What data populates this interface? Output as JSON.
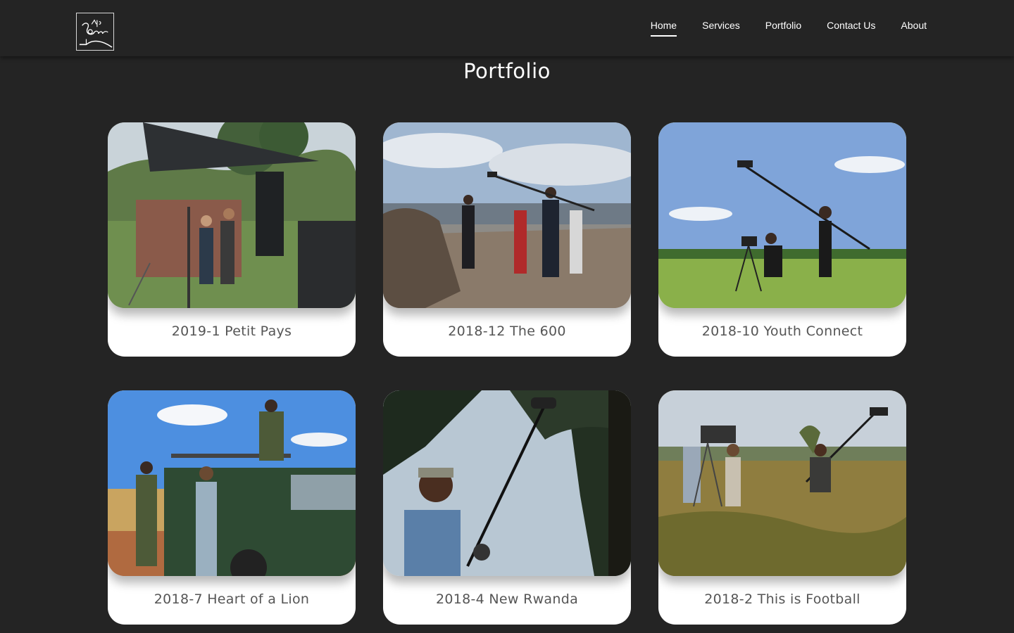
{
  "header": {
    "logo_alt": "Safari Sound",
    "nav": [
      {
        "label": "Home",
        "active": true
      },
      {
        "label": "Services",
        "active": false
      },
      {
        "label": "Portfolio",
        "active": false
      },
      {
        "label": "Contact Us",
        "active": false
      },
      {
        "label": "About",
        "active": false
      }
    ]
  },
  "main": {
    "title": "Portfolio",
    "projects": [
      {
        "title": "2019-1 Petit Pays",
        "image": "film-set-tent-photo"
      },
      {
        "title": "2018-12 The 600",
        "image": "crew-at-memorial-photo"
      },
      {
        "title": "2018-10 Youth Connect",
        "image": "boom-operator-field-photo"
      },
      {
        "title": "2018-7 Heart of a Lion",
        "image": "crew-with-truck-photo"
      },
      {
        "title": "2018-4 New Rwanda",
        "image": "sound-recordist-trees-photo"
      },
      {
        "title": "2018-2 This is Football",
        "image": "crew-in-grassland-photo"
      }
    ]
  },
  "colors": {
    "background": "#242424",
    "card": "#ffffff",
    "caption": "#555555",
    "nav_text": "#ffffff"
  }
}
